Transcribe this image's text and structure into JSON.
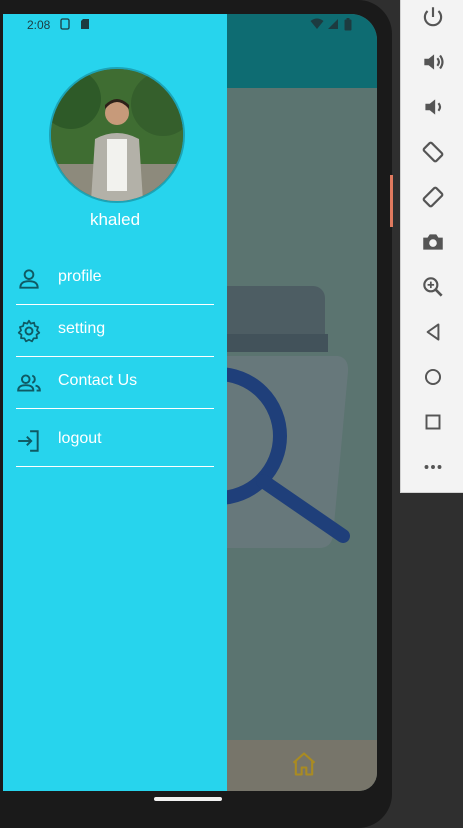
{
  "status_bar": {
    "time": "2:08"
  },
  "drawer": {
    "username": "khaled",
    "menu": [
      {
        "label": "profile",
        "icon": "person-icon"
      },
      {
        "label": "setting",
        "icon": "gear-icon"
      },
      {
        "label": "Contact Us",
        "icon": "people-icon"
      },
      {
        "label": "logout",
        "icon": "login-icon"
      }
    ]
  },
  "emulator_controls": [
    "power-icon",
    "volume-up-icon",
    "volume-down-icon",
    "rotate-left-icon",
    "rotate-right-icon",
    "camera-icon",
    "zoom-icon",
    "back-icon",
    "home-circle-icon",
    "overview-icon",
    "more-icon"
  ],
  "colors": {
    "drawer": "#27d4ed",
    "appbar": "#0e6c72",
    "scrim_bg": "#5b7470"
  }
}
